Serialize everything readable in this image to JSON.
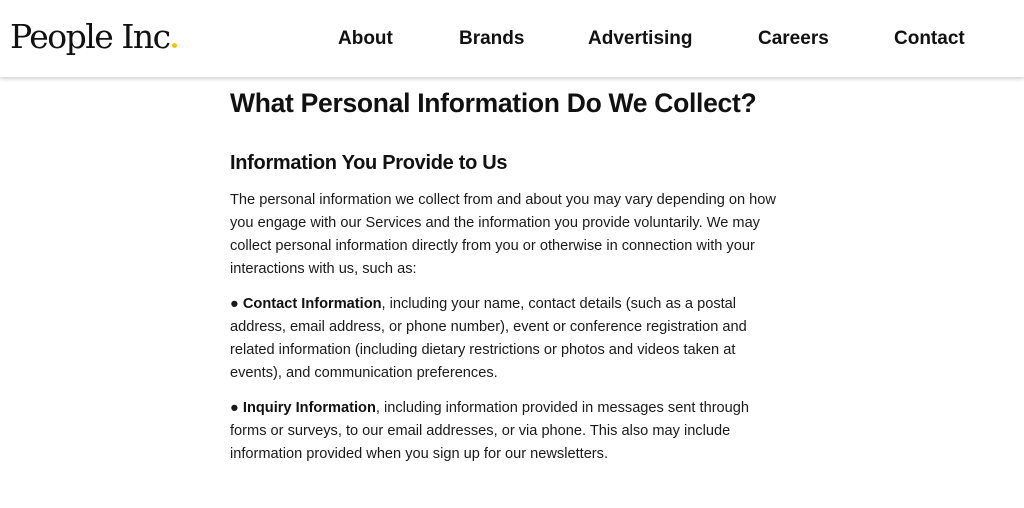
{
  "brand": {
    "logo_text": "People Inc",
    "logo_dot": ".",
    "dot_color": "#f2c500"
  },
  "nav": {
    "items": [
      {
        "label": "About"
      },
      {
        "label": "Brands"
      },
      {
        "label": "Advertising"
      },
      {
        "label": "Careers"
      },
      {
        "label": "Contact"
      }
    ]
  },
  "article": {
    "heading": "What Personal Information Do We Collect?",
    "subheading": "Information You Provide to Us",
    "intro": "The personal information we collect from and about you may vary depending on how you engage with our Services and the information you provide voluntarily.  We may collect personal information directly from you or otherwise in connection with your interactions with us, such as:",
    "bullets": [
      {
        "marker": "●",
        "term": "Contact Information",
        "text": ", including your name, contact details (such as a postal address, email address, or phone number), event or conference registration and related information (including dietary restrictions or photos and videos taken at events), and communication preferences."
      },
      {
        "marker": "●",
        "term": "Inquiry Information",
        "text": ", including information provided in messages sent through forms or surveys, to our email addresses, or via phone. This also may include information provided when you sign up for our newsletters."
      }
    ]
  }
}
